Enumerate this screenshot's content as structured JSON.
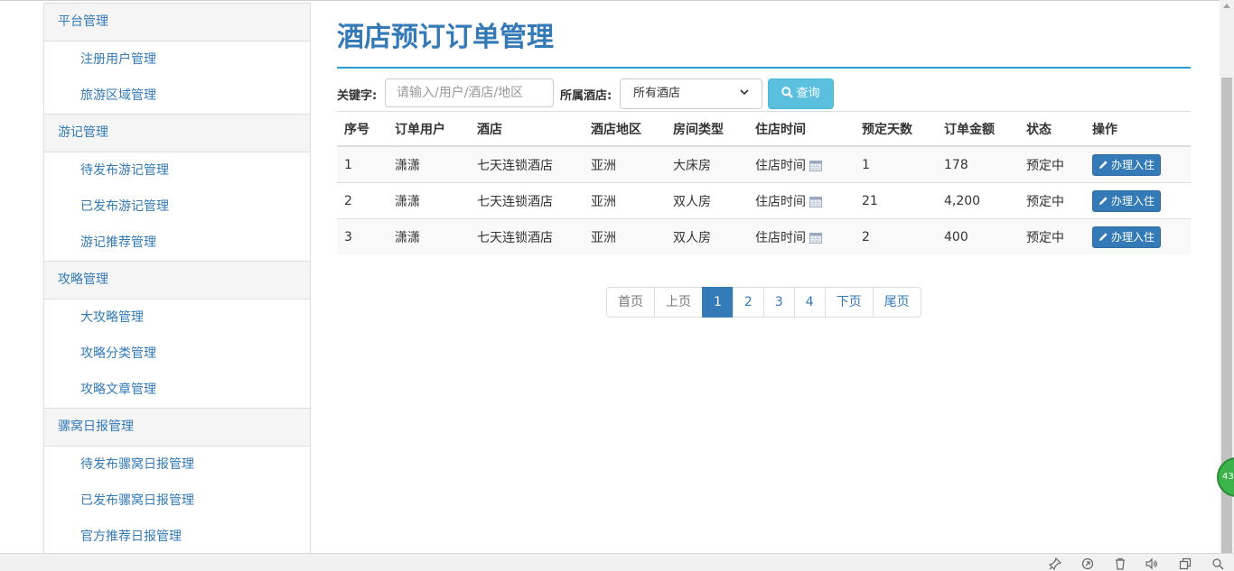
{
  "sidebar": {
    "groups": [
      {
        "title": "平台管理",
        "items": [
          "注册用户管理",
          "旅游区域管理"
        ]
      },
      {
        "title": "游记管理",
        "items": [
          "待发布游记管理",
          "已发布游记管理",
          "游记推荐管理"
        ]
      },
      {
        "title": "攻略管理",
        "items": [
          "大攻略管理",
          "攻略分类管理",
          "攻略文章管理"
        ]
      },
      {
        "title": "骡窝日报管理",
        "items": [
          "待发布骡窝日报管理",
          "已发布骡窝日报管理",
          "官方推荐日报管理"
        ]
      }
    ]
  },
  "page": {
    "title": "酒店预订订单管理"
  },
  "search": {
    "keyword_label": "关键字:",
    "keyword_placeholder": "请输入/用户/酒店/地区",
    "hotel_label": "所属酒店:",
    "hotel_selected": "所有酒店",
    "query_button": "查询"
  },
  "table": {
    "headers": [
      "序号",
      "订单用户",
      "酒店",
      "酒店地区",
      "房间类型",
      "住店时间",
      "预定天数",
      "订单金额",
      "状态",
      "操作"
    ],
    "rows": [
      {
        "index": "1",
        "user": "潇潇",
        "hotel": "七天连锁酒店",
        "region": "亚洲",
        "room": "大床房",
        "checkin": "住店时间",
        "days": "1",
        "amount": "178",
        "status": "预定中",
        "action": "办理入住"
      },
      {
        "index": "2",
        "user": "潇潇",
        "hotel": "七天连锁酒店",
        "region": "亚洲",
        "room": "双人房",
        "checkin": "住店时间",
        "days": "21",
        "amount": "4,200",
        "status": "预定中",
        "action": "办理入住"
      },
      {
        "index": "3",
        "user": "潇潇",
        "hotel": "七天连锁酒店",
        "region": "亚洲",
        "room": "双人房",
        "checkin": "住店时间",
        "days": "2",
        "amount": "400",
        "status": "预定中",
        "action": "办理入住"
      }
    ]
  },
  "pagination": {
    "first": "首页",
    "prev": "上页",
    "pages": [
      "1",
      "2",
      "3",
      "4"
    ],
    "current": "1",
    "next": "下页",
    "last": "尾页"
  },
  "badge": {
    "text": "43"
  },
  "colors": {
    "primary": "#337ab7",
    "info": "#5bc0de",
    "rule": "#2b9bd6"
  },
  "icons": {
    "query": "search-icon",
    "action": "pencil-icon",
    "date": "calendar-icon"
  }
}
